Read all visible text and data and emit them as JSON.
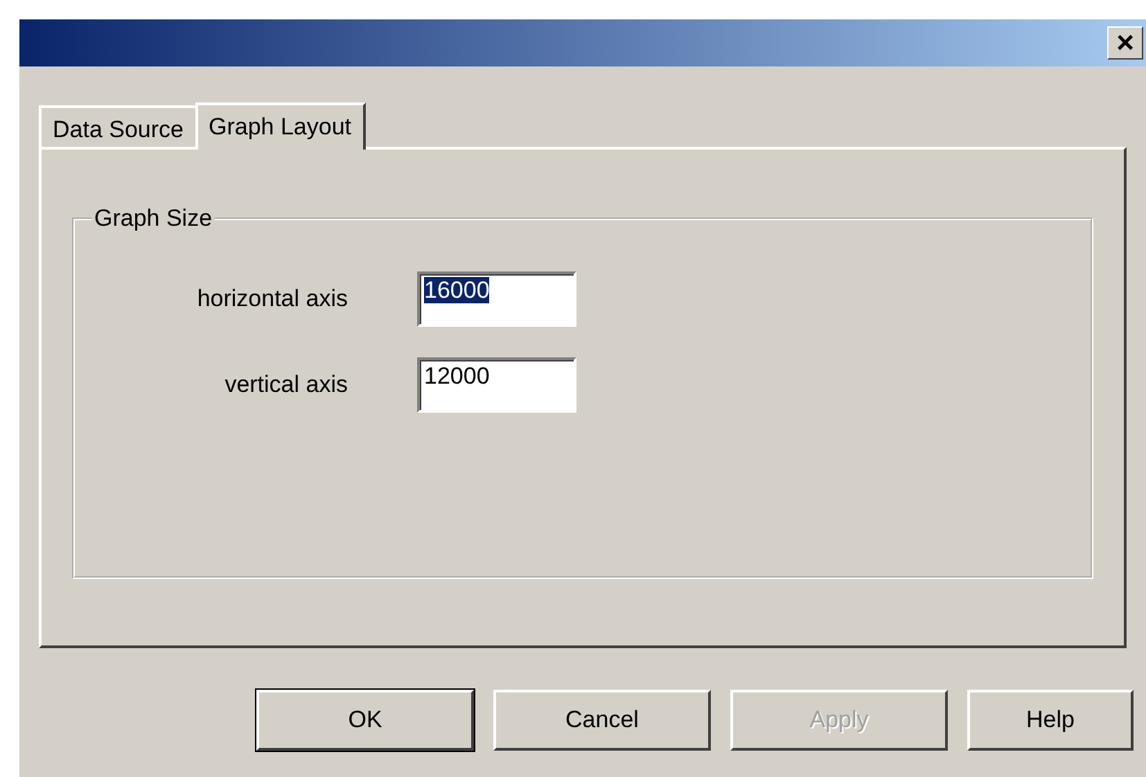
{
  "window": {
    "title_close": "×"
  },
  "tabs": [
    {
      "label": "Data Source",
      "selected": false
    },
    {
      "label": "Graph Layout",
      "selected": true
    }
  ],
  "group": {
    "title": "Graph Size",
    "fields": [
      {
        "label": "horizontal axis",
        "value": "16000",
        "selected": true
      },
      {
        "label": "vertical axis",
        "value": "12000",
        "selected": false
      }
    ]
  },
  "buttons": [
    {
      "label": "OK",
      "default": true,
      "disabled": false
    },
    {
      "label": "Cancel",
      "default": false,
      "disabled": false
    },
    {
      "label": "Apply",
      "default": false,
      "disabled": true
    },
    {
      "label": "Help",
      "default": false,
      "disabled": false
    }
  ]
}
